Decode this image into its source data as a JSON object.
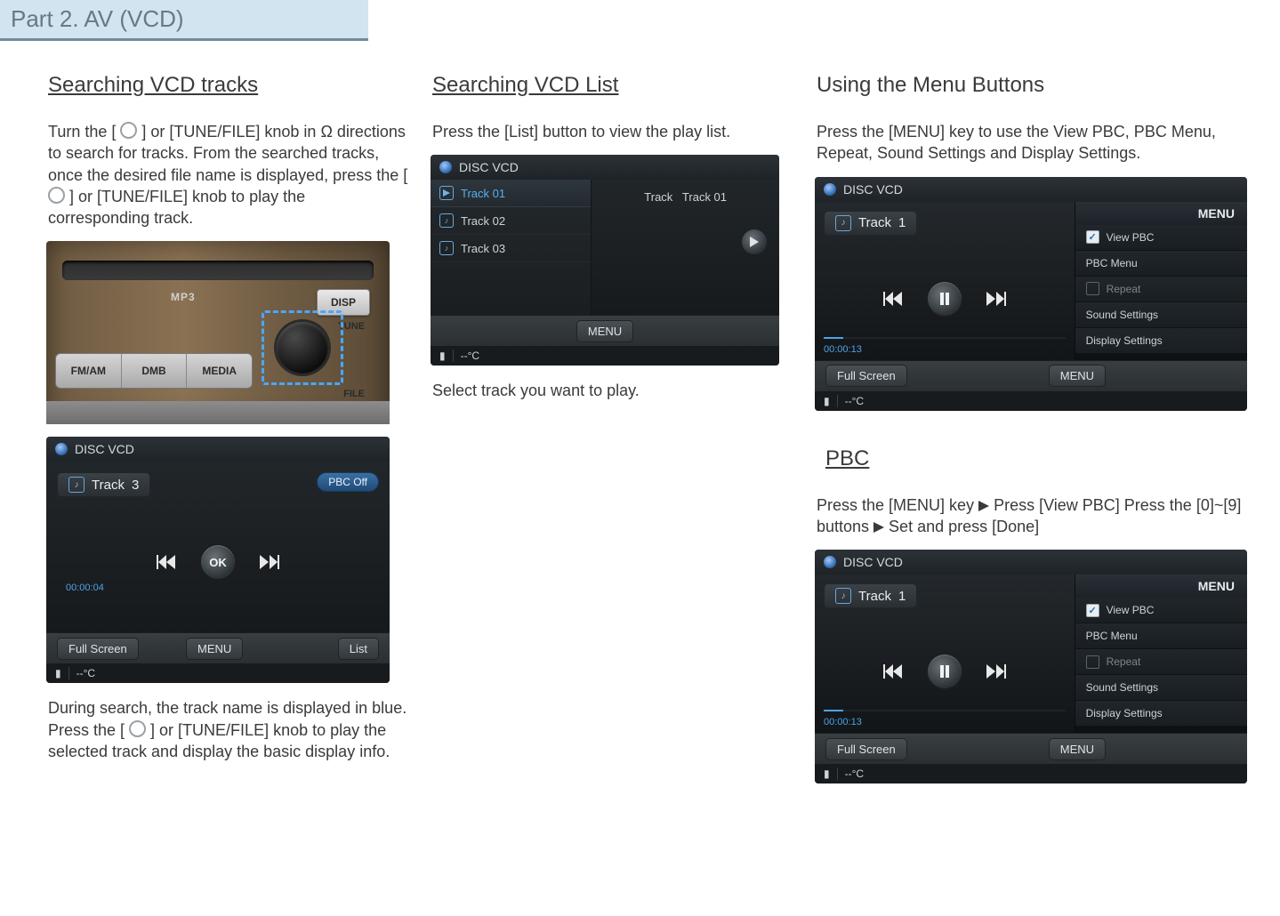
{
  "banner": "Part 2. AV (VCD)",
  "col1": {
    "title": "Searching VCD tracks",
    "p1a": "Turn the [ ",
    "p1b": " ] or [TUNE/FILE] knob in Ω directions to search for tracks. From the searched tracks, once the desired file name is displayed, press the [ ",
    "p1c": " ] or [TUNE/FILE] knob to play the corresponding track.",
    "stereo": {
      "mp3": "MP3",
      "disp": "DISP",
      "tune": "TUNE",
      "file": "FILE",
      "buttons": [
        "FM/AM",
        "DMB",
        "MEDIA"
      ]
    },
    "screen": {
      "header": "DISC VCD",
      "track_label": "Track",
      "track_no": "3",
      "pbc": "PBC Off",
      "ok": "OK",
      "time": "00:00:04",
      "full": "Full Screen",
      "menu": "MENU",
      "list": "List",
      "temp": "--°C"
    },
    "p2a": "During search, the track name is displayed in blue. Press the [ ",
    "p2b": " ] or [TUNE/FILE] knob to play the selected track and display the basic display info."
  },
  "col2": {
    "title": "Searching VCD List",
    "p1": "Press the [List] button to view the play list.",
    "screen": {
      "header": "DISC VCD",
      "items": [
        {
          "label": "Track 01",
          "selected": true
        },
        {
          "label": "Track 02",
          "selected": false
        },
        {
          "label": "Track 03",
          "selected": false
        }
      ],
      "info_prefix": "Track",
      "info_value": "Track 01",
      "menu": "MENU",
      "temp": "--°C"
    },
    "p2": "Select track you want to play."
  },
  "col3": {
    "title": "Using the Menu Buttons",
    "p1": "Press the [MENU] key to use the View PBC, PBC Menu, Repeat, Sound Settings and Display Settings.",
    "menu_screen": {
      "header": "DISC VCD",
      "track_label": "Track",
      "track_no": "1",
      "time": "00:00:13",
      "full": "Full Screen",
      "menu": "MENU",
      "temp": "--°C",
      "menu_title": "MENU",
      "items": [
        {
          "label": "View PBC",
          "check": "checked"
        },
        {
          "label": "PBC Menu",
          "check": "none"
        },
        {
          "label": "Repeat",
          "check": "empty",
          "muted": true
        },
        {
          "label": "Sound Settings",
          "check": "none"
        },
        {
          "label": "Display Settings",
          "check": "none"
        }
      ]
    },
    "pbc_title": "PBC",
    "p2a": "Press the [MENU] key ",
    "p2b": " Press [View PBC] Press the [0]~[9] buttons ",
    "p2c": " Set and press [Done]"
  }
}
